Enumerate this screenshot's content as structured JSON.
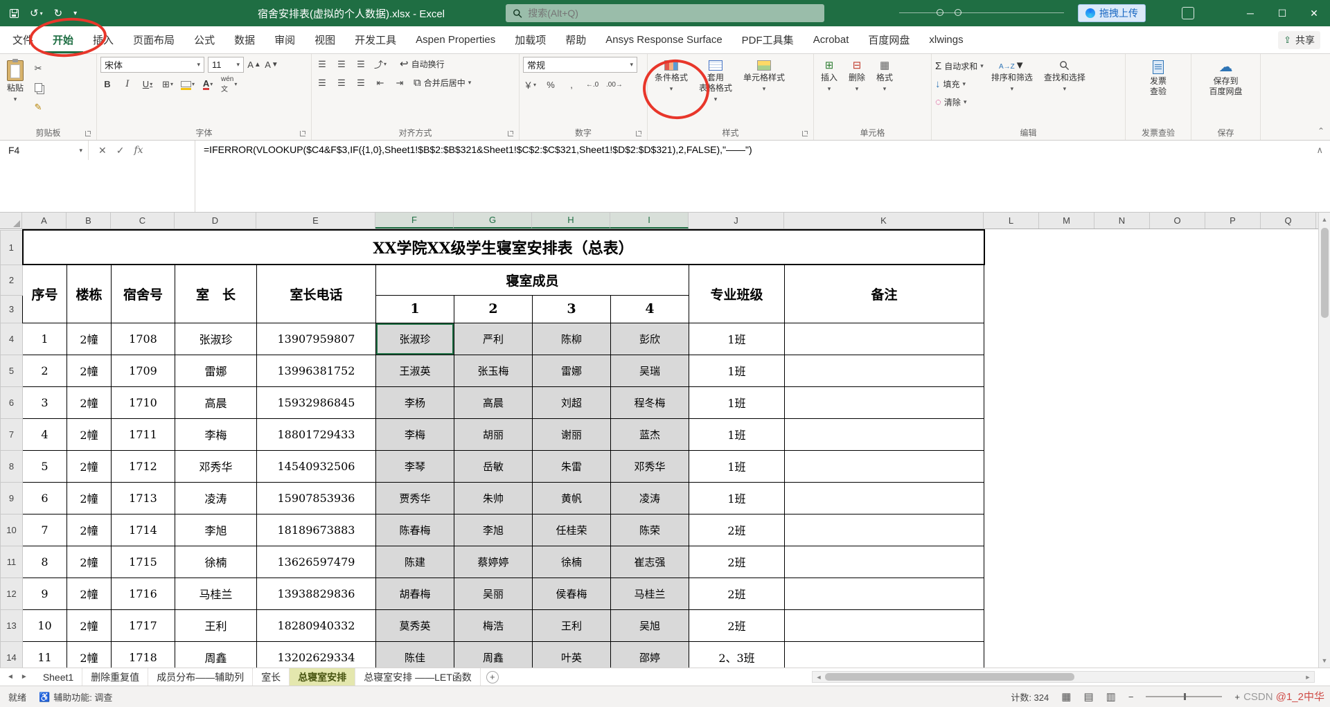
{
  "titlebar": {
    "title": "宿舍安排表(虚拟的个人数据).xlsx - Excel",
    "search": "搜索(Alt+Q)",
    "upload": "拖拽上传",
    "window": {
      "minimize": "─",
      "maximize": "☐",
      "close": "✕"
    }
  },
  "tabs": {
    "file": "文件",
    "items": [
      "开始",
      "插入",
      "页面布局",
      "公式",
      "数据",
      "审阅",
      "视图",
      "开发工具",
      "Aspen Properties",
      "加载项",
      "帮助",
      "Ansys Response Surface",
      "PDF工具集",
      "Acrobat",
      "百度网盘",
      "xlwings"
    ],
    "active": "开始",
    "share": "共享"
  },
  "ribbon": {
    "paste": "粘贴",
    "clipboard_label": "剪贴板",
    "font_name": "宋体",
    "font_size": "11",
    "font_label": "字体",
    "wrap_text": "自动换行",
    "merge_center": "合并后居中",
    "alignment_label": "对齐方式",
    "number_format": "常规",
    "number_label": "数字",
    "conditional_formatting": "条件格式",
    "format_as_table": "套用\n表格格式",
    "cell_styles": "单元格样式",
    "styles_label": "样式",
    "insert": "插入",
    "delete": "删除",
    "format": "格式",
    "cells_label": "单元格",
    "autosum": "自动求和",
    "fill": "填充",
    "clear": "清除",
    "sort_filter": "排序和筛选",
    "find_select": "查找和选择",
    "editing_label": "编辑",
    "invoice_check": "发票\n查验",
    "invoice_label": "发票查验",
    "save_baidu": "保存到\n百度网盘",
    "save_label": "保存"
  },
  "formula_bar": {
    "name_box": "F4",
    "formula": "=IFERROR(VLOOKUP($C4&F$3,IF({1,0},Sheet1!$B$2:$B$321&Sheet1!$C$2:$C$321,Sheet1!$D$2:$D$321),2,FALSE),\"——\")"
  },
  "grid": {
    "columns": [
      "A",
      "B",
      "C",
      "D",
      "E",
      "F",
      "G",
      "H",
      "I",
      "J",
      "K",
      "L",
      "M",
      "N",
      "O",
      "P",
      "Q"
    ],
    "selected_columns": [
      "F",
      "G",
      "H",
      "I"
    ],
    "title": "XX学院XX级学生寝室安排表（总表）",
    "headers": {
      "num": "序号",
      "building": "楼栋",
      "room": "宿舍号",
      "leader": "室　长",
      "phone": "室长电话",
      "members": "寝室成员",
      "member_cols": [
        "1",
        "2",
        "3",
        "4"
      ],
      "class": "专业班级",
      "note": "备注"
    },
    "rows": [
      {
        "num": "1",
        "building": "2幢",
        "room": "1708",
        "leader": "张淑珍",
        "phone": "13907959807",
        "members": [
          "张淑珍",
          "严利",
          "陈柳",
          "彭欣"
        ],
        "class": "1班",
        "note": ""
      },
      {
        "num": "2",
        "building": "2幢",
        "room": "1709",
        "leader": "雷娜",
        "phone": "13996381752",
        "members": [
          "王淑英",
          "张玉梅",
          "雷娜",
          "吴瑞"
        ],
        "class": "1班",
        "note": ""
      },
      {
        "num": "3",
        "building": "2幢",
        "room": "1710",
        "leader": "高晨",
        "phone": "15932986845",
        "members": [
          "李杨",
          "高晨",
          "刘超",
          "程冬梅"
        ],
        "class": "1班",
        "note": ""
      },
      {
        "num": "4",
        "building": "2幢",
        "room": "1711",
        "leader": "李梅",
        "phone": "18801729433",
        "members": [
          "李梅",
          "胡丽",
          "谢丽",
          "蓝杰"
        ],
        "class": "1班",
        "note": ""
      },
      {
        "num": "5",
        "building": "2幢",
        "room": "1712",
        "leader": "邓秀华",
        "phone": "14540932506",
        "members": [
          "李琴",
          "岳敏",
          "朱雷",
          "邓秀华"
        ],
        "class": "1班",
        "note": ""
      },
      {
        "num": "6",
        "building": "2幢",
        "room": "1713",
        "leader": "凌涛",
        "phone": "15907853936",
        "members": [
          "贾秀华",
          "朱帅",
          "黄帆",
          "凌涛"
        ],
        "class": "1班",
        "note": ""
      },
      {
        "num": "7",
        "building": "2幢",
        "room": "1714",
        "leader": "李旭",
        "phone": "18189673883",
        "members": [
          "陈春梅",
          "李旭",
          "任桂荣",
          "陈荣"
        ],
        "class": "2班",
        "note": ""
      },
      {
        "num": "8",
        "building": "2幢",
        "room": "1715",
        "leader": "徐楠",
        "phone": "13626597479",
        "members": [
          "陈建",
          "蔡婷婷",
          "徐楠",
          "崔志强"
        ],
        "class": "2班",
        "note": ""
      },
      {
        "num": "9",
        "building": "2幢",
        "room": "1716",
        "leader": "马桂兰",
        "phone": "13938829836",
        "members": [
          "胡春梅",
          "吴丽",
          "侯春梅",
          "马桂兰"
        ],
        "class": "2班",
        "note": ""
      },
      {
        "num": "10",
        "building": "2幢",
        "room": "1717",
        "leader": "王利",
        "phone": "18280940332",
        "members": [
          "莫秀英",
          "梅浩",
          "王利",
          "吴旭"
        ],
        "class": "2班",
        "note": ""
      },
      {
        "num": "11",
        "building": "2幢",
        "room": "1718",
        "leader": "周鑫",
        "phone": "13202629334",
        "members": [
          "陈佳",
          "周鑫",
          "叶英",
          "邵婷"
        ],
        "class": "2、3班",
        "note": ""
      }
    ]
  },
  "sheet_tabs": {
    "items": [
      "Sheet1",
      "删除重复值",
      "成员分布——辅助列",
      "室长",
      "总寝室安排",
      "总寝室安排 ——LET函数"
    ],
    "active": "总寝室安排"
  },
  "status_bar": {
    "ready": "就绪",
    "accessibility": "辅助功能: 调查",
    "count": "计数: 324"
  },
  "watermark": {
    "part1": "CSDN ",
    "part2": "@1_2中华"
  },
  "colors": {
    "accent_green": "#1f6e43",
    "member_cell_gray": "#d9d9d9",
    "annotation_red": "#e8362a"
  }
}
